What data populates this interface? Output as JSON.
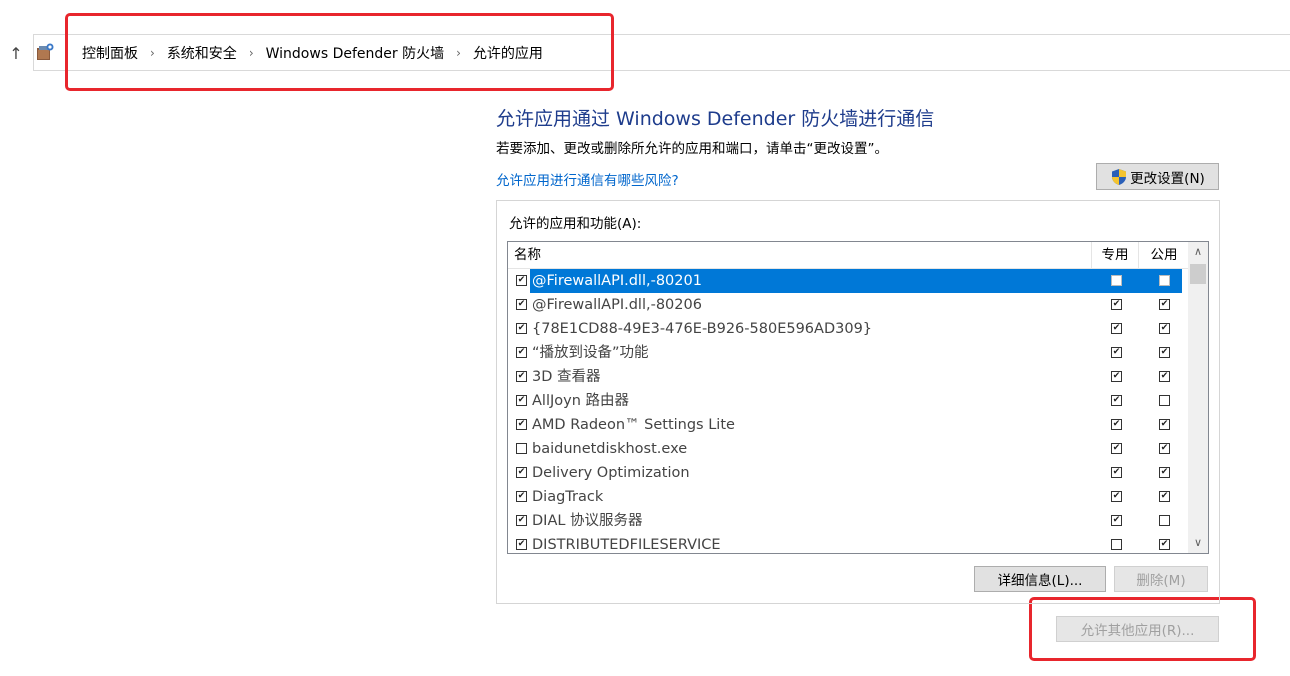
{
  "breadcrumb": [
    "控制面板",
    "系统和安全",
    "Windows Defender 防火墙",
    "允许的应用"
  ],
  "title": "允许应用通过 Windows Defender 防火墙进行通信",
  "description": "若要添加、更改或删除所允许的应用和端口，请单击“更改设置”。",
  "risk_link": "允许应用进行通信有哪些风险?",
  "change_settings_label": "更改设置(N)",
  "panel_label": "允许的应用和功能(A):",
  "columns": {
    "name": "名称",
    "private": "专用",
    "public": "公用"
  },
  "rows": [
    {
      "name": "@FirewallAPI.dll,-80201",
      "enabled": true,
      "private": false,
      "public": false,
      "selected": true
    },
    {
      "name": "@FirewallAPI.dll,-80206",
      "enabled": true,
      "private": true,
      "public": true
    },
    {
      "name": "{78E1CD88-49E3-476E-B926-580E596AD309}",
      "enabled": true,
      "private": true,
      "public": true
    },
    {
      "name": "“播放到设备”功能",
      "enabled": true,
      "private": true,
      "public": true
    },
    {
      "name": "3D 查看器",
      "enabled": true,
      "private": true,
      "public": true
    },
    {
      "name": "AllJoyn 路由器",
      "enabled": true,
      "private": true,
      "public": false
    },
    {
      "name": "AMD Radeon™ Settings Lite",
      "enabled": true,
      "private": true,
      "public": true
    },
    {
      "name": "baidunetdiskhost.exe",
      "enabled": false,
      "private": true,
      "public": true
    },
    {
      "name": "Delivery Optimization",
      "enabled": true,
      "private": true,
      "public": true
    },
    {
      "name": "DiagTrack",
      "enabled": true,
      "private": true,
      "public": true
    },
    {
      "name": "DIAL 协议服务器",
      "enabled": true,
      "private": true,
      "public": false
    },
    {
      "name": "DISTRIBUTEDFILESERVICE",
      "enabled": true,
      "private": false,
      "public": true
    }
  ],
  "details_label": "详细信息(L)...",
  "remove_label": "删除(M)",
  "allow_other_label": "允许其他应用(R)...",
  "icons": {
    "up": "up-arrow-icon",
    "control_panel": "control-panel-icon",
    "shield": "uac-shield-icon",
    "chevron": "chevron-right-icon",
    "check": "checkmark-icon"
  },
  "colors": {
    "accent": "#0078d7",
    "title": "#1e3c8c",
    "link": "#0066cc",
    "annotation": "#e8262d"
  }
}
